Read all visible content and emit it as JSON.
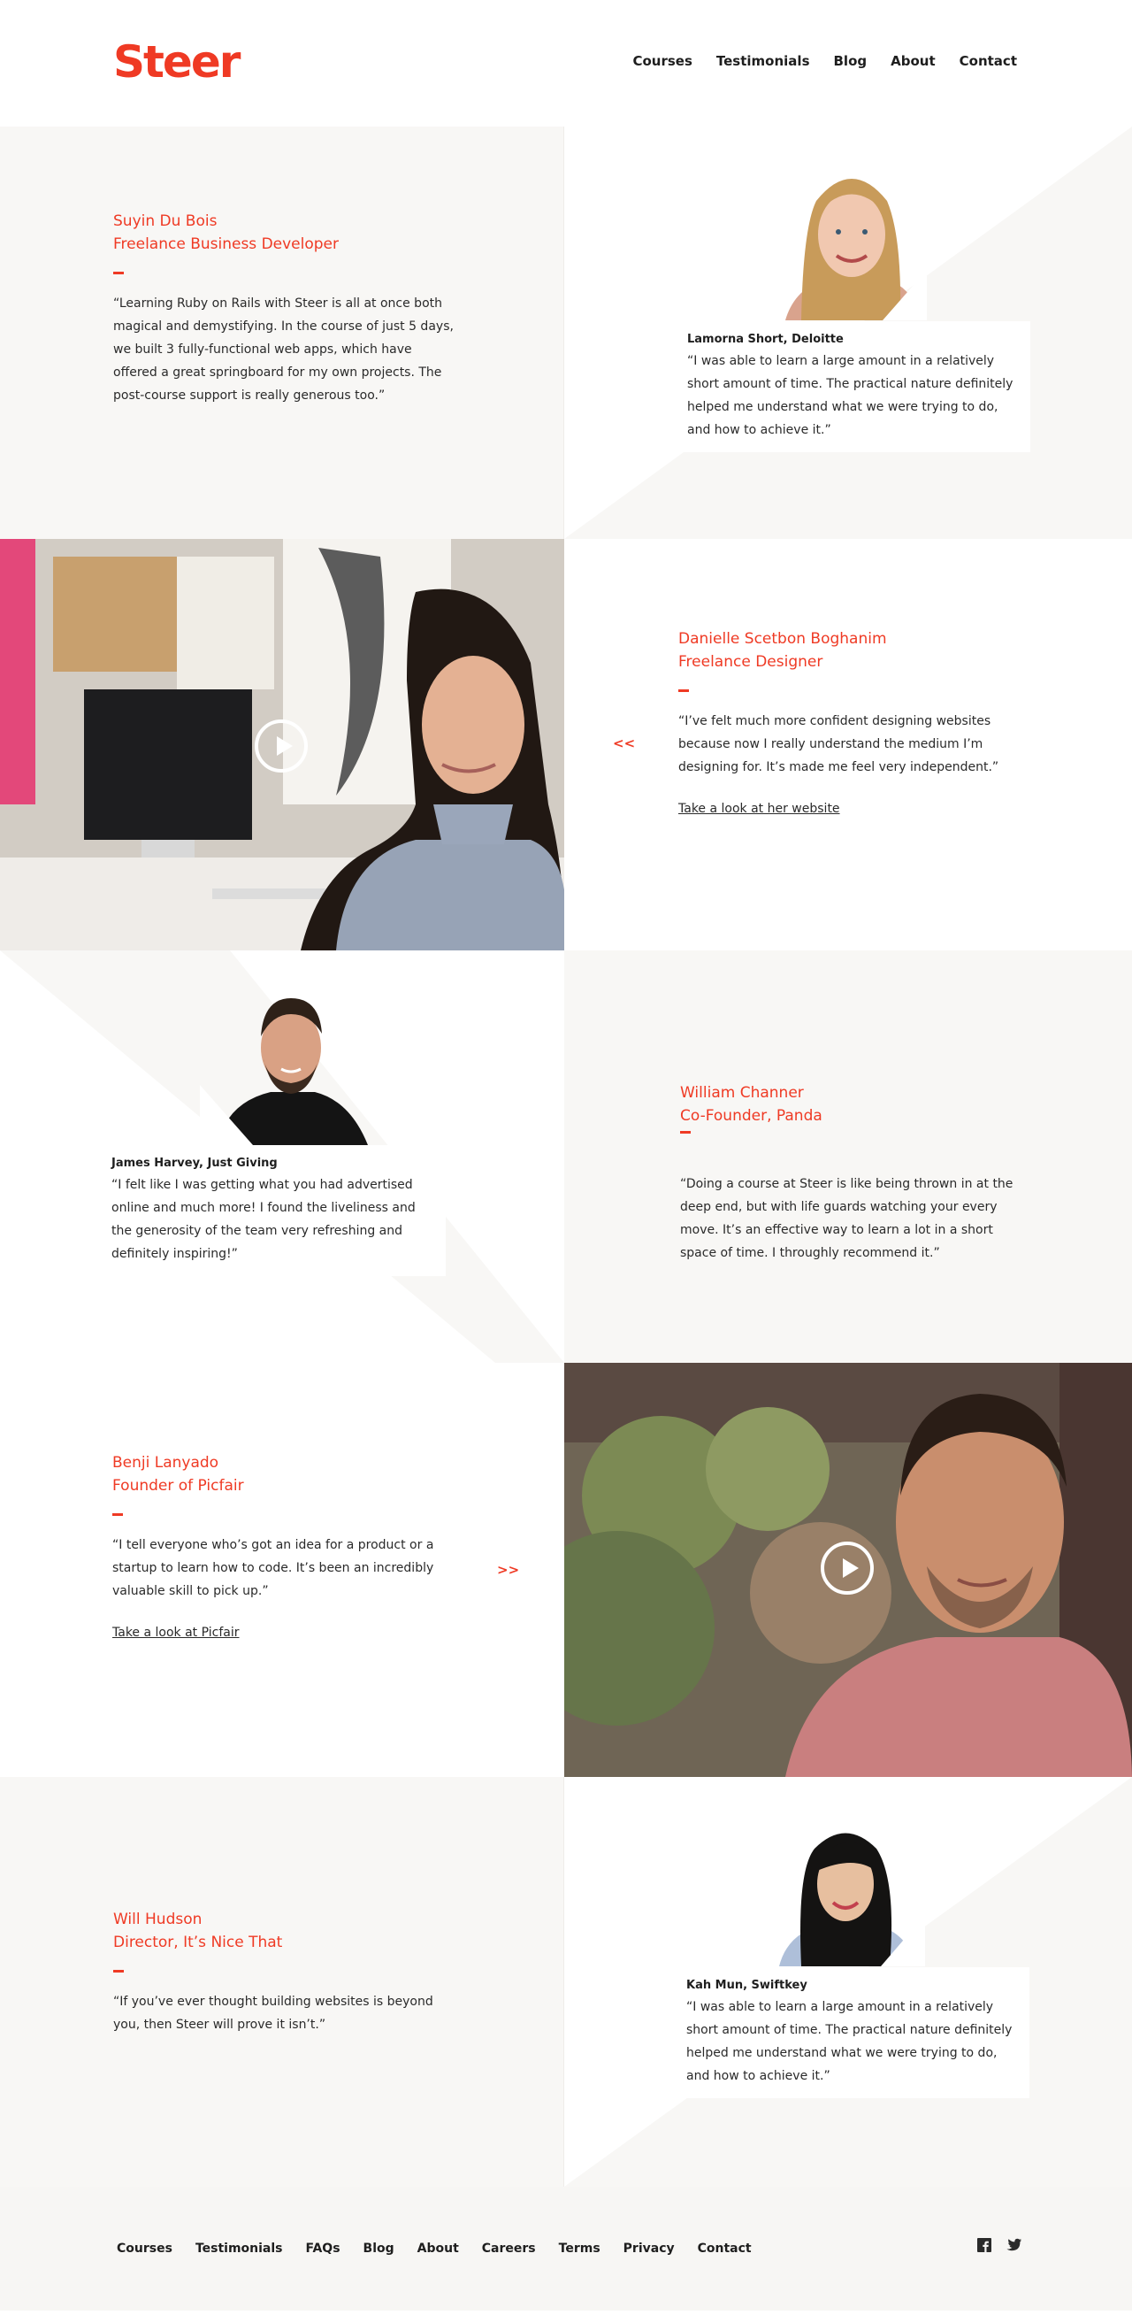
{
  "brand": {
    "logo": "Steer",
    "accent": "#ef3a24"
  },
  "nav": {
    "items": [
      "Courses",
      "Testimonials",
      "Blog",
      "About",
      "Contact"
    ]
  },
  "row1": {
    "left": {
      "name": "Suyin Du Bois",
      "role": "Freelance Business Developer",
      "quote": "“Learning Ruby on Rails with Steer is all at once both magical and demystifying. In the course of just 5 days, we built 3 fully-functional web apps, which have offered a great springboard for my own projects. The post-course support is really generous too.”"
    },
    "right": {
      "author": "Lamorna Short, Deloitte",
      "quote": "“I was able to learn a large amount in a relatively short amount of time. The practical nature definitely helped me understand what we were trying to do, and how to achieve it.”"
    }
  },
  "row2": {
    "arrow": "<<",
    "right": {
      "name": "Danielle Scetbon Boghanim",
      "role": "Freelance Designer",
      "quote": "“I’ve felt much more confident designing websites because now I really understand the medium I’m designing for. It’s made me feel very independent.”",
      "link": "Take a look at her website"
    }
  },
  "row3": {
    "left": {
      "author": "James Harvey, Just Giving",
      "quote": "“I felt like I was getting what you had advertised online and much more! I found the liveliness and the generosity of the team very refreshing and definitely inspiring!”"
    },
    "right": {
      "name": "William Channer",
      "role": "Co-Founder, Panda",
      "quote": "“Doing a course at Steer is like being thrown in at the deep end, but with life guards watching your every move. It’s an effective way to learn a lot in a short space of time. I throughly recommend it.”"
    }
  },
  "row4": {
    "arrow": ">>",
    "left": {
      "name": "Benji Lanyado",
      "role": "Founder of Picfair",
      "quote": "“I tell everyone who’s got an idea for a product or a startup to learn how to code. It’s been an incredibly valuable skill to pick up.”",
      "link": "Take a look at Picfair"
    }
  },
  "row5": {
    "left": {
      "name": "Will Hudson",
      "role": "Director, It’s Nice That",
      "quote": "“If you’ve ever thought building websites is beyond you, then Steer will prove it isn’t.”"
    },
    "right": {
      "author": "Kah Mun, Swiftkey",
      "quote": "“I was able to learn a large amount in a relatively short amount of time. The practical nature definitely helped me understand what we were trying to do, and how to achieve it.”"
    }
  },
  "footer": {
    "items": [
      "Courses",
      "Testimonials",
      "FAQs",
      "Blog",
      "About",
      "Careers",
      "Terms",
      "Privacy",
      "Contact"
    ],
    "social": [
      "facebook-icon",
      "twitter-icon"
    ]
  }
}
